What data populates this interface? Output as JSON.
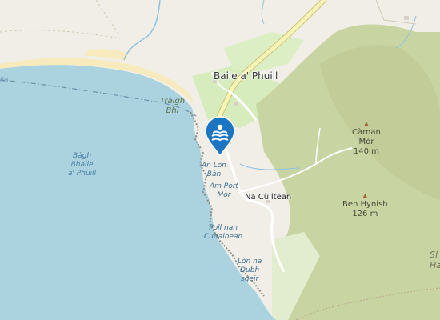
{
  "map": {
    "labels": {
      "village_main": "Baile a' Phuill",
      "village_second": "Na Cùiltean",
      "beach": [
        "Tràigh",
        "Bhì"
      ],
      "bay": [
        "Bàgh",
        "Bhaile",
        "a' Phuill"
      ],
      "coast_1": [
        "An Lon",
        "Bàn"
      ],
      "coast_2": [
        "Am Port",
        "Mòr"
      ],
      "coast_3": [
        "Poll nan",
        "Cudainean"
      ],
      "coast_4": [
        "Lòn na",
        "Dubh",
        "sgeir"
      ],
      "edge_left": "ite",
      "edge_right": [
        "Sl",
        "Ha"
      ]
    },
    "peaks": [
      {
        "name": "Càrnan Mòr",
        "name_line1": "Càrnan",
        "name_line2": "Mòr",
        "elevation": "140 m"
      },
      {
        "name": "Ben Hynish",
        "elevation": "126 m"
      }
    ],
    "marker": {
      "icon": "swimming-icon",
      "color": "#1a76c2"
    },
    "colors": {
      "sea": "#aad3df",
      "sea_deep": "#82b8d2",
      "land": "#f1eee8",
      "beach": "#fbf0c8",
      "grass": "#cde7b0",
      "hill": "#c8d3a4",
      "hill_dark": "#b9c38f",
      "road_major": "#f7f4b5",
      "road_outline": "#c9c27a"
    }
  }
}
